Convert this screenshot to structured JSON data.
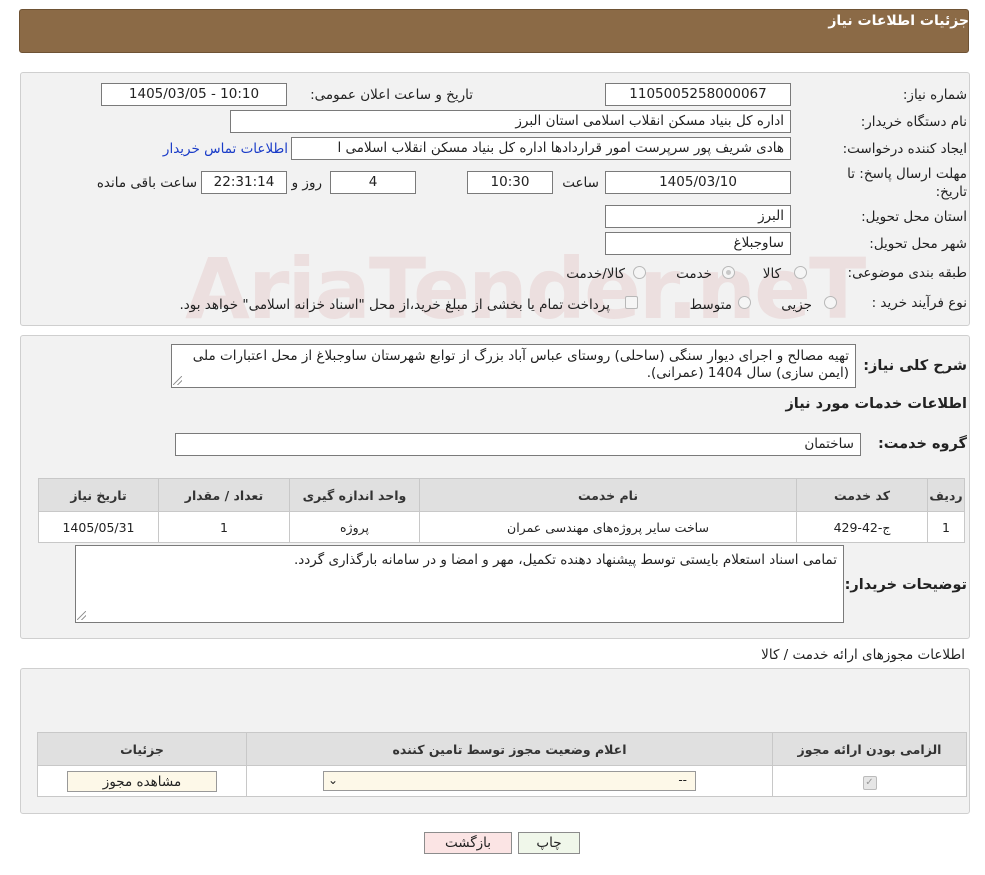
{
  "header": {
    "title": "جزئیات اطلاعات نیاز"
  },
  "form": {
    "need_number": {
      "label": "شماره نیاز:",
      "value": "1105005258000067"
    },
    "announce_datetime": {
      "label": "تاریخ و ساعت اعلان عمومی:",
      "value": "1405/03/05 - 10:10"
    },
    "buyer_org": {
      "label": "نام دستگاه خریدار:",
      "value": "اداره کل بنیاد مسکن انقلاب اسلامی استان البرز"
    },
    "requester": {
      "label": "ایجاد کننده درخواست:",
      "value": "هادی شریف پور سرپرست امور قراردادها اداره کل بنیاد مسکن انقلاب اسلامی ا"
    },
    "contact_link": "اطلاعات تماس خریدار",
    "deadline": {
      "label": "مهلت ارسال پاسخ: تا تاریخ:",
      "date": "1405/03/10",
      "time_label": "ساعت",
      "time": "10:30",
      "days": "4",
      "days_label": "روز و",
      "remaining": "22:31:14",
      "remaining_label": "ساعت باقی مانده"
    },
    "province": {
      "label": "استان محل تحویل:",
      "value": "البرز"
    },
    "city": {
      "label": "شهر محل تحویل:",
      "value": "ساوجبلاغ"
    },
    "category": {
      "label": "طبقه بندی موضوعی:",
      "options": [
        "کالا",
        "خدمت",
        "کالا/خدمت"
      ],
      "selected": "خدمت"
    },
    "process": {
      "label": "نوع فرآیند خرید :",
      "options": [
        "جزیی",
        "متوسط"
      ],
      "note": "پرداخت تمام یا بخشی از مبلغ خرید،از محل \"اسناد خزانه اسلامی\" خواهد بود."
    }
  },
  "summary": {
    "label": "شرح کلی نیاز:",
    "text": "تهیه مصالح و اجرای دیوار سنگی (ساحلی) روستای عباس آباد بزرگ از توابع شهرستان ساوجبلاغ از محل اعتبارات ملی (ایمن سازی) سال 1404 (عمرانی)."
  },
  "services": {
    "section_title": "اطلاعات خدمات مورد نیاز",
    "group_label": "گروه خدمت:",
    "group_value": "ساختمان",
    "columns": [
      "ردیف",
      "کد خدمت",
      "نام خدمت",
      "واحد اندازه گیری",
      "تعداد / مقدار",
      "تاریخ نیاز"
    ],
    "rows": [
      {
        "row": "1",
        "code": "ج-42-429",
        "name": "ساخت سایر پروژه‌های مهندسی عمران",
        "unit": "پروژه",
        "qty": "1",
        "date": "1405/05/31"
      }
    ]
  },
  "buyer_notes": {
    "label": "توضیحات خریدار:",
    "text": "تمامی اسناد استعلام بایستی توسط پیشنهاد دهنده تکمیل، مهر و امضا و در سامانه بارگذاری گردد."
  },
  "permits": {
    "section_title": "اطلاعات مجوزهای ارائه خدمت / کالا",
    "columns": [
      "الزامی بودن ارائه مجوز",
      "اعلام وضعیت مجوز توسط تامین کننده",
      "جزئیات"
    ],
    "row": {
      "select_value": "--",
      "view_button": "مشاهده مجوز"
    }
  },
  "footer": {
    "print": "چاپ",
    "back": "بازگشت"
  },
  "watermark": "AriaTender.neT"
}
